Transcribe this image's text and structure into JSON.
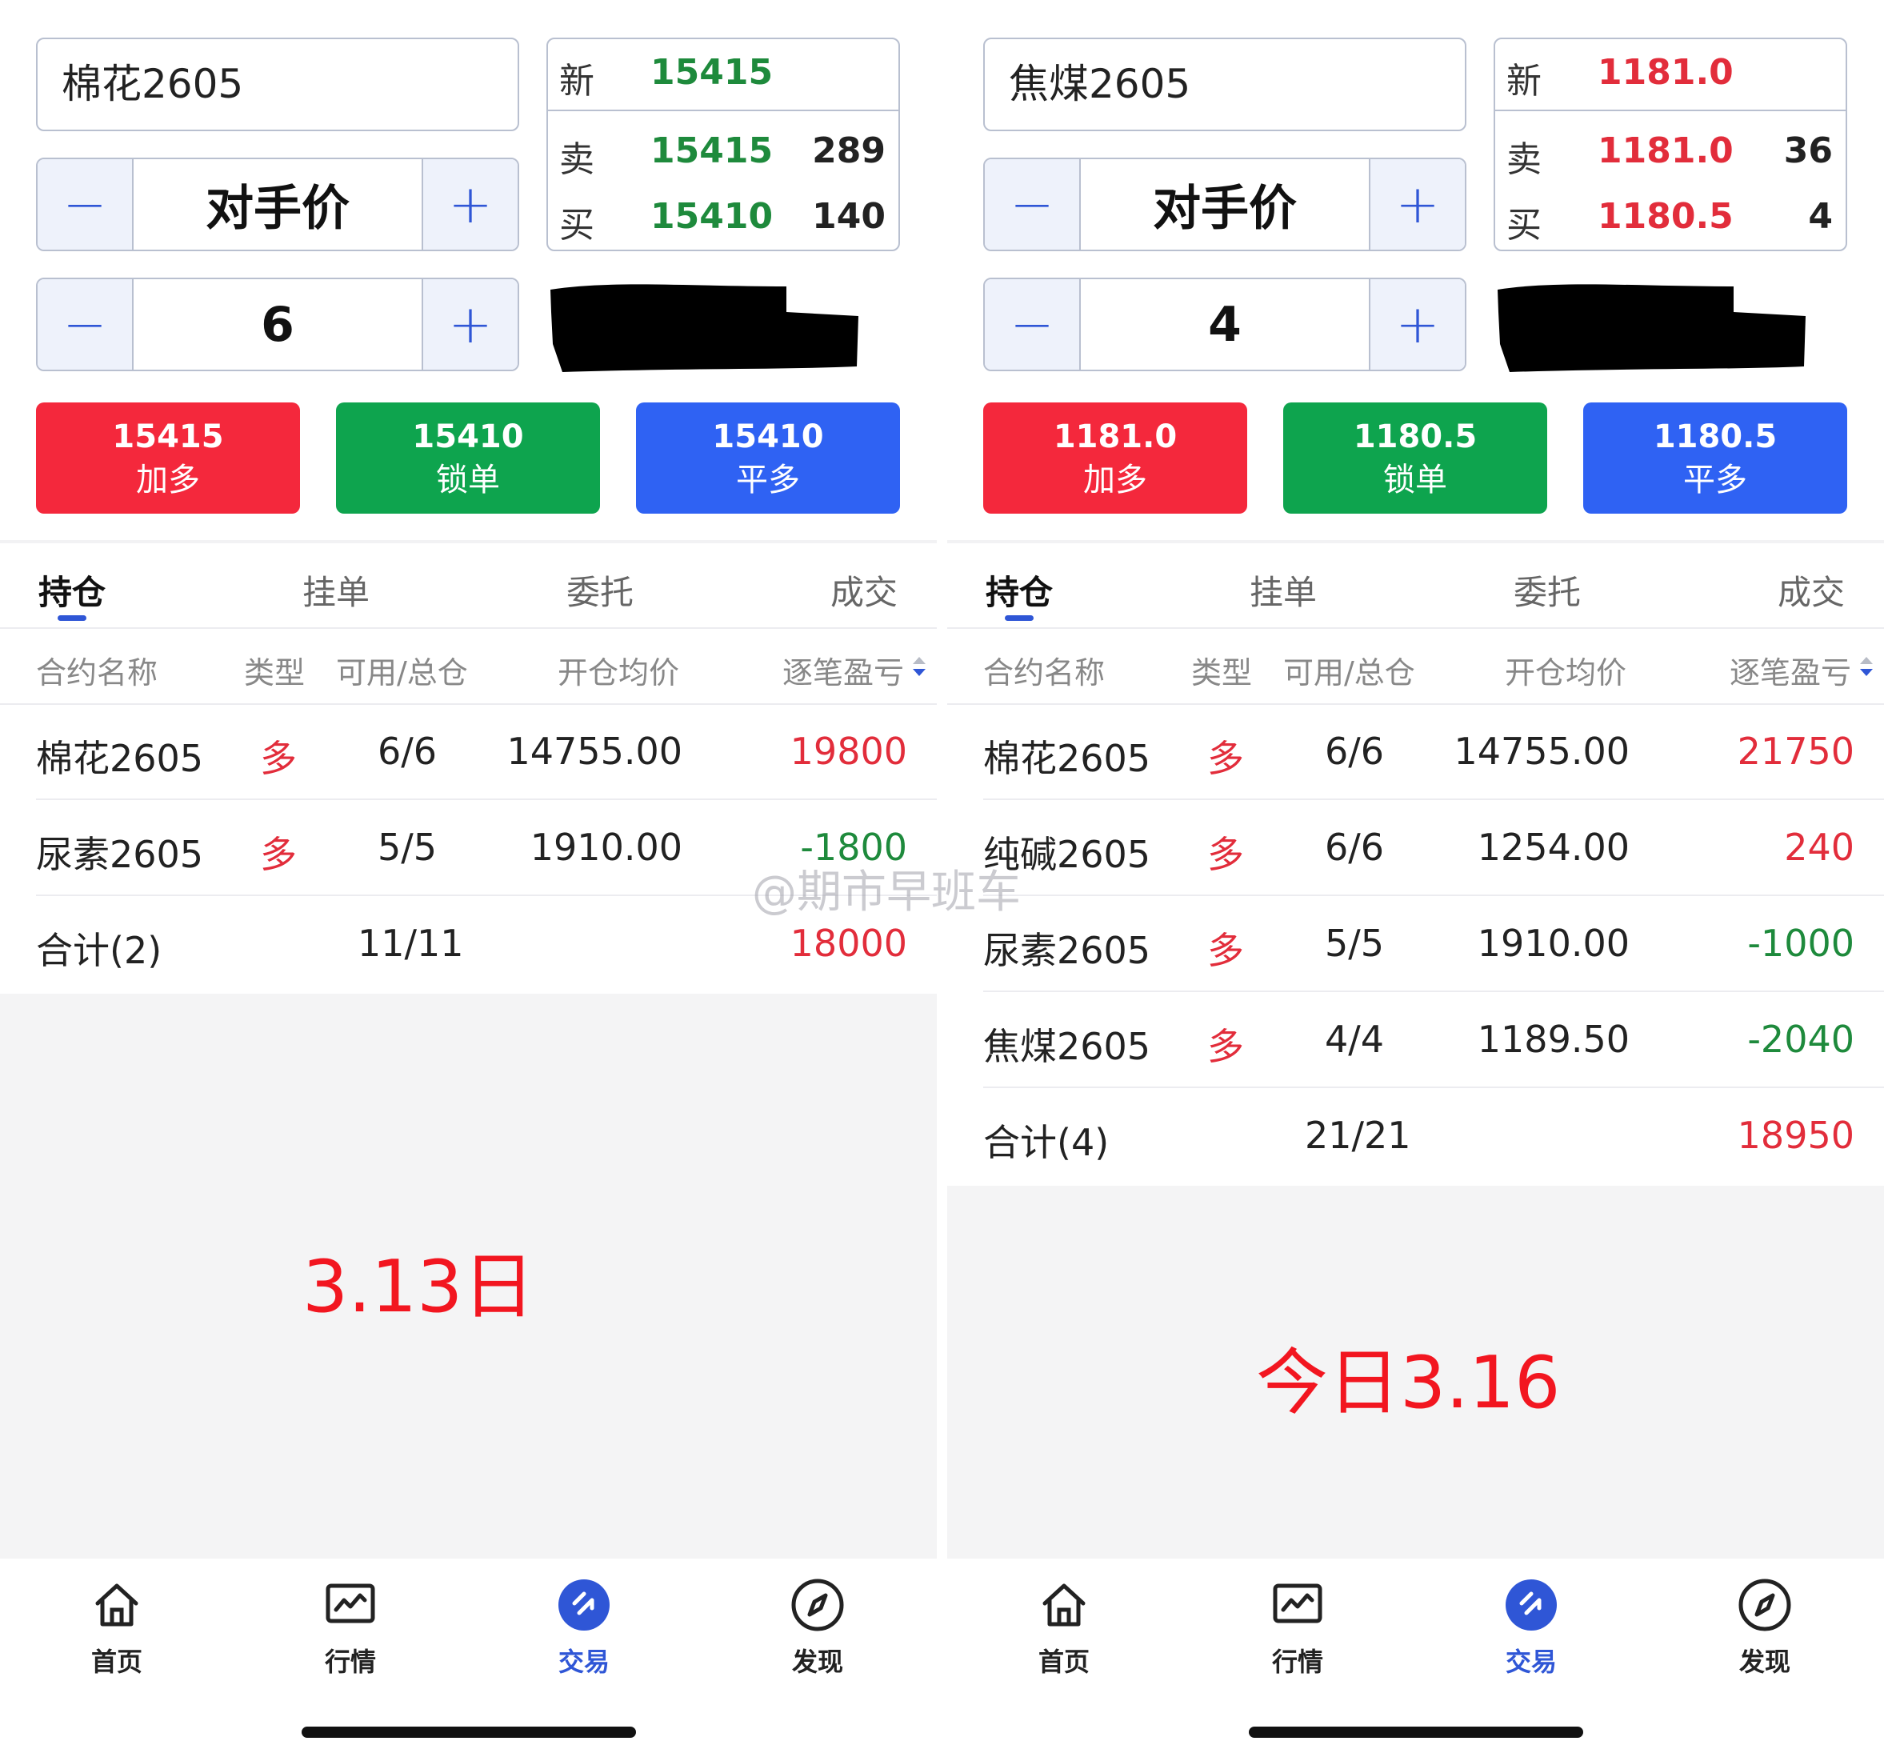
{
  "left": {
    "instrument": "棉花2605",
    "price_mode": "对手价",
    "qty": "6",
    "quote": {
      "new_label": "新",
      "new_price": "15415",
      "sell_label": "卖",
      "sell_price": "15415",
      "sell_qty": "289",
      "buy_label": "买",
      "buy_price": "15410",
      "buy_qty": "140",
      "color": "#1e8a3c"
    },
    "actions": [
      {
        "price": "15415",
        "label": "加多"
      },
      {
        "price": "15410",
        "label": "锁单"
      },
      {
        "price": "15410",
        "label": "平多"
      }
    ],
    "tabs": [
      "持仓",
      "挂单",
      "委托",
      "成交"
    ],
    "headers": [
      "合约名称",
      "类型",
      "可用/总仓",
      "开仓均价",
      "逐笔盈亏"
    ],
    "rows": [
      {
        "name": "棉花2605",
        "type": "多",
        "qty": "6/6",
        "avg": "14755.00",
        "pnl": "19800",
        "sign": "pos"
      },
      {
        "name": "尿素2605",
        "type": "多",
        "qty": "5/5",
        "avg": "1910.00",
        "pnl": "-1800",
        "sign": "neg"
      }
    ],
    "total": {
      "label": "合计(2)",
      "qty": "11/11",
      "pnl": "18000"
    },
    "stamp": "3.13日"
  },
  "right": {
    "instrument": "焦煤2605",
    "price_mode": "对手价",
    "qty": "4",
    "quote": {
      "new_label": "新",
      "new_price": "1181.0",
      "sell_label": "卖",
      "sell_price": "1181.0",
      "sell_qty": "36",
      "buy_label": "买",
      "buy_price": "1180.5",
      "buy_qty": "4",
      "color": "#e22d3b"
    },
    "actions": [
      {
        "price": "1181.0",
        "label": "加多"
      },
      {
        "price": "1180.5",
        "label": "锁单"
      },
      {
        "price": "1180.5",
        "label": "平多"
      }
    ],
    "tabs": [
      "持仓",
      "挂单",
      "委托",
      "成交"
    ],
    "headers": [
      "合约名称",
      "类型",
      "可用/总仓",
      "开仓均价",
      "逐笔盈亏"
    ],
    "rows": [
      {
        "name": "棉花2605",
        "type": "多",
        "qty": "6/6",
        "avg": "14755.00",
        "pnl": "21750",
        "sign": "pos"
      },
      {
        "name": "纯碱2605",
        "type": "多",
        "qty": "6/6",
        "avg": "1254.00",
        "pnl": "240",
        "sign": "pos"
      },
      {
        "name": "尿素2605",
        "type": "多",
        "qty": "5/5",
        "avg": "1910.00",
        "pnl": "-1000",
        "sign": "neg"
      },
      {
        "name": "焦煤2605",
        "type": "多",
        "qty": "4/4",
        "avg": "1189.50",
        "pnl": "-2040",
        "sign": "neg"
      }
    ],
    "total": {
      "label": "合计(4)",
      "qty": "21/21",
      "pnl": "18950"
    },
    "stamp": "今日3.16"
  },
  "nav": [
    {
      "label": "首页",
      "icon": "home-icon"
    },
    {
      "label": "行情",
      "icon": "chart-icon"
    },
    {
      "label": "交易",
      "icon": "trade-icon",
      "active": true
    },
    {
      "label": "发现",
      "icon": "compass-icon"
    }
  ],
  "watermark": "@期市早班车",
  "colors": {
    "accent": "#2f56d6",
    "buy_red": "#f4283c",
    "lock_green": "#0ea44e",
    "close_blue": "#2f62f3",
    "profit": "#e22d3b",
    "loss": "#1e8a3c"
  }
}
